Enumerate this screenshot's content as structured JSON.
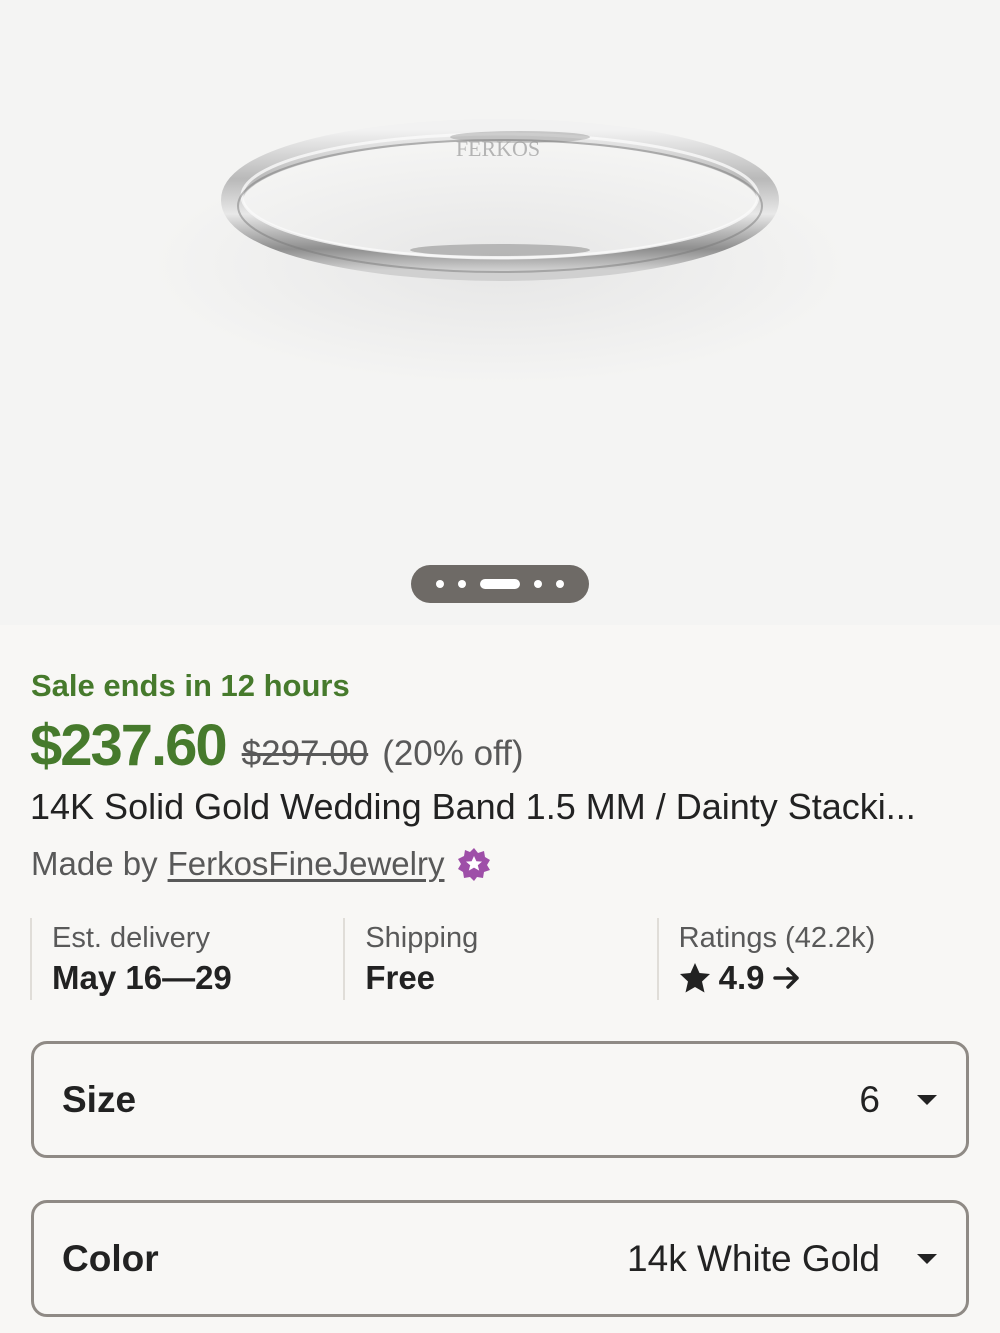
{
  "carousel": {
    "dot_count": 5,
    "active_index": 2
  },
  "sale": {
    "banner": "Sale ends in 12 hours"
  },
  "price": {
    "current": "$237.60",
    "original": "$297.00",
    "discount": "(20% off)"
  },
  "product": {
    "title": "14K Solid Gold Wedding Band 1.5 MM / Dainty Stacki...",
    "made_by_prefix": "Made by",
    "shop_name": "FerkosFineJewelry",
    "badge_icon": "star-seller-badge-icon",
    "image_engraving": "FERKOS"
  },
  "info": {
    "delivery": {
      "label": "Est. delivery",
      "value": "May 16—29"
    },
    "shipping": {
      "label": "Shipping",
      "value": "Free"
    },
    "ratings": {
      "label": "Ratings (42.2k)",
      "value": "4.9",
      "star_icon": "star-icon",
      "arrow_icon": "arrow-right-icon"
    }
  },
  "options": {
    "size": {
      "label": "Size",
      "value": "6"
    },
    "color": {
      "label": "Color",
      "value": "14k White Gold"
    }
  },
  "colors": {
    "sale_green": "#467a2c",
    "badge_purple": "#9e4fa8",
    "text_primary": "#222222",
    "text_secondary": "#595959"
  }
}
